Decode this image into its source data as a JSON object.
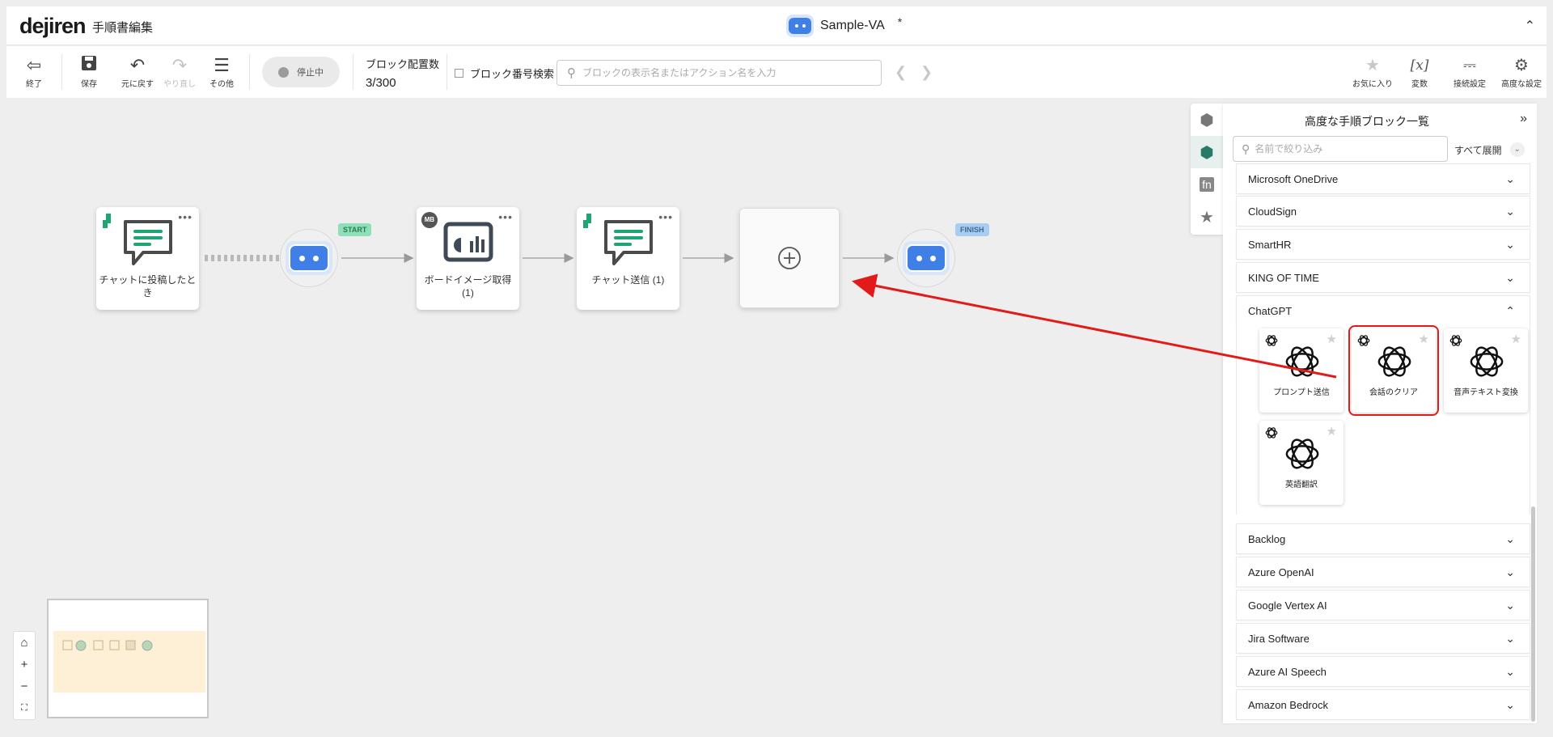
{
  "header": {
    "logo": "dejiren",
    "page_title": "手順書編集",
    "va_name": "Sample-VA",
    "unsaved_mark": "*"
  },
  "toolbar": {
    "exit": "終了",
    "save": "保存",
    "undo": "元に戻す",
    "redo": "やり直し",
    "other": "その他",
    "status_toggle": "停止中",
    "block_count_label": "ブロック配置数",
    "block_count_value": "3/300",
    "block_number_search": "ブロック番号検索",
    "search_placeholder": "ブロックの表示名またはアクション名を入力",
    "favorites": "お気に入り",
    "variables": "変数",
    "connection_settings": "接続設定",
    "advanced_settings": "高度な設定"
  },
  "canvas": {
    "nodes": [
      {
        "label": "チャットに投稿したとき"
      },
      {
        "label": "ボードイメージ取得 (1)",
        "badge": "MB"
      },
      {
        "label": "チャット送信 (1)"
      }
    ],
    "start_flag": "START",
    "finish_flag": "FINISH"
  },
  "panel": {
    "title": "高度な手順ブロック一覧",
    "filter_placeholder": "名前で絞り込み",
    "expand_all": "すべて展開",
    "categories_top": [
      "Microsoft OneDrive",
      "CloudSign",
      "SmartHR",
      "KING OF TIME"
    ],
    "open_category": "ChatGPT",
    "chatgpt_blocks": [
      "プロンプト送信",
      "会話のクリア",
      "音声テキスト変換",
      "英語翻訳"
    ],
    "categories_bottom": [
      "Backlog",
      "Azure OpenAI",
      "Google Vertex AI",
      "Jira Software",
      "Azure AI Speech",
      "Amazon Bedrock"
    ]
  },
  "colors": {
    "accent_blue": "#3f7fe6",
    "brand_green": "#1ea672",
    "highlight_red": "#e21a1a"
  }
}
